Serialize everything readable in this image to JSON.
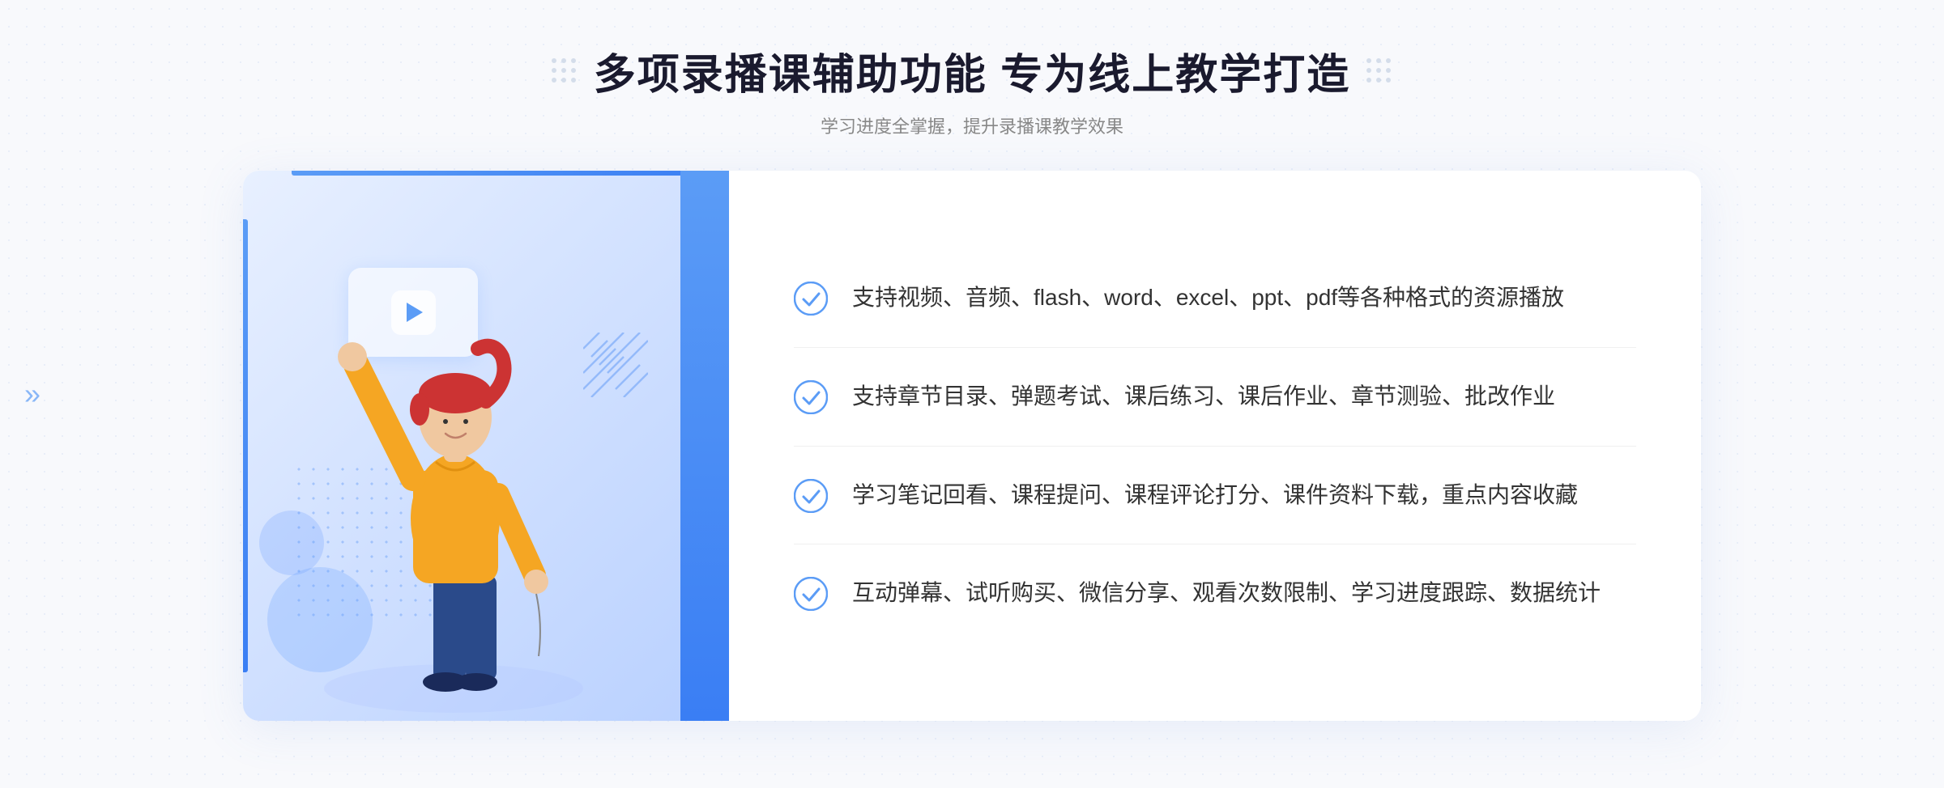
{
  "header": {
    "title": "多项录播课辅助功能 专为线上教学打造",
    "subtitle": "学习进度全掌握，提升录播课教学效果"
  },
  "features": [
    {
      "id": "feature-1",
      "text": "支持视频、音频、flash、word、excel、ppt、pdf等各种格式的资源播放"
    },
    {
      "id": "feature-2",
      "text": "支持章节目录、弹题考试、课后练习、课后作业、章节测验、批改作业"
    },
    {
      "id": "feature-3",
      "text": "学习笔记回看、课程提问、课程评论打分、课件资料下载，重点内容收藏"
    },
    {
      "id": "feature-4",
      "text": "互动弹幕、试听购买、微信分享、观看次数限制、学习进度跟踪、数据统计"
    }
  ],
  "colors": {
    "primary": "#5b9cf6",
    "primary_dark": "#3a7ef4",
    "title": "#1a1a2e",
    "text": "#333333",
    "subtitle": "#888888"
  },
  "icons": {
    "check": "check-circle-icon",
    "play": "play-icon",
    "left_arrow": "left-arrow-icon"
  }
}
